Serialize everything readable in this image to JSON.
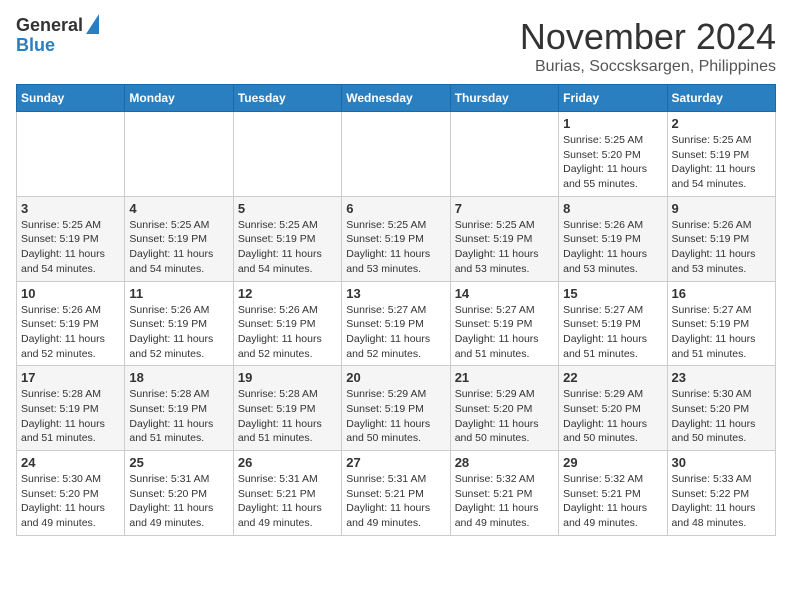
{
  "logo": {
    "line1": "General",
    "line2": "Blue"
  },
  "title": "November 2024",
  "subtitle": "Burias, Soccsksargen, Philippines",
  "weekdays": [
    "Sunday",
    "Monday",
    "Tuesday",
    "Wednesday",
    "Thursday",
    "Friday",
    "Saturday"
  ],
  "weeks": [
    [
      {
        "day": "",
        "info": ""
      },
      {
        "day": "",
        "info": ""
      },
      {
        "day": "",
        "info": ""
      },
      {
        "day": "",
        "info": ""
      },
      {
        "day": "",
        "info": ""
      },
      {
        "day": "1",
        "info": "Sunrise: 5:25 AM\nSunset: 5:20 PM\nDaylight: 11 hours\nand 55 minutes."
      },
      {
        "day": "2",
        "info": "Sunrise: 5:25 AM\nSunset: 5:19 PM\nDaylight: 11 hours\nand 54 minutes."
      }
    ],
    [
      {
        "day": "3",
        "info": "Sunrise: 5:25 AM\nSunset: 5:19 PM\nDaylight: 11 hours\nand 54 minutes."
      },
      {
        "day": "4",
        "info": "Sunrise: 5:25 AM\nSunset: 5:19 PM\nDaylight: 11 hours\nand 54 minutes."
      },
      {
        "day": "5",
        "info": "Sunrise: 5:25 AM\nSunset: 5:19 PM\nDaylight: 11 hours\nand 54 minutes."
      },
      {
        "day": "6",
        "info": "Sunrise: 5:25 AM\nSunset: 5:19 PM\nDaylight: 11 hours\nand 53 minutes."
      },
      {
        "day": "7",
        "info": "Sunrise: 5:25 AM\nSunset: 5:19 PM\nDaylight: 11 hours\nand 53 minutes."
      },
      {
        "day": "8",
        "info": "Sunrise: 5:26 AM\nSunset: 5:19 PM\nDaylight: 11 hours\nand 53 minutes."
      },
      {
        "day": "9",
        "info": "Sunrise: 5:26 AM\nSunset: 5:19 PM\nDaylight: 11 hours\nand 53 minutes."
      }
    ],
    [
      {
        "day": "10",
        "info": "Sunrise: 5:26 AM\nSunset: 5:19 PM\nDaylight: 11 hours\nand 52 minutes."
      },
      {
        "day": "11",
        "info": "Sunrise: 5:26 AM\nSunset: 5:19 PM\nDaylight: 11 hours\nand 52 minutes."
      },
      {
        "day": "12",
        "info": "Sunrise: 5:26 AM\nSunset: 5:19 PM\nDaylight: 11 hours\nand 52 minutes."
      },
      {
        "day": "13",
        "info": "Sunrise: 5:27 AM\nSunset: 5:19 PM\nDaylight: 11 hours\nand 52 minutes."
      },
      {
        "day": "14",
        "info": "Sunrise: 5:27 AM\nSunset: 5:19 PM\nDaylight: 11 hours\nand 51 minutes."
      },
      {
        "day": "15",
        "info": "Sunrise: 5:27 AM\nSunset: 5:19 PM\nDaylight: 11 hours\nand 51 minutes."
      },
      {
        "day": "16",
        "info": "Sunrise: 5:27 AM\nSunset: 5:19 PM\nDaylight: 11 hours\nand 51 minutes."
      }
    ],
    [
      {
        "day": "17",
        "info": "Sunrise: 5:28 AM\nSunset: 5:19 PM\nDaylight: 11 hours\nand 51 minutes."
      },
      {
        "day": "18",
        "info": "Sunrise: 5:28 AM\nSunset: 5:19 PM\nDaylight: 11 hours\nand 51 minutes."
      },
      {
        "day": "19",
        "info": "Sunrise: 5:28 AM\nSunset: 5:19 PM\nDaylight: 11 hours\nand 51 minutes."
      },
      {
        "day": "20",
        "info": "Sunrise: 5:29 AM\nSunset: 5:19 PM\nDaylight: 11 hours\nand 50 minutes."
      },
      {
        "day": "21",
        "info": "Sunrise: 5:29 AM\nSunset: 5:20 PM\nDaylight: 11 hours\nand 50 minutes."
      },
      {
        "day": "22",
        "info": "Sunrise: 5:29 AM\nSunset: 5:20 PM\nDaylight: 11 hours\nand 50 minutes."
      },
      {
        "day": "23",
        "info": "Sunrise: 5:30 AM\nSunset: 5:20 PM\nDaylight: 11 hours\nand 50 minutes."
      }
    ],
    [
      {
        "day": "24",
        "info": "Sunrise: 5:30 AM\nSunset: 5:20 PM\nDaylight: 11 hours\nand 49 minutes."
      },
      {
        "day": "25",
        "info": "Sunrise: 5:31 AM\nSunset: 5:20 PM\nDaylight: 11 hours\nand 49 minutes."
      },
      {
        "day": "26",
        "info": "Sunrise: 5:31 AM\nSunset: 5:21 PM\nDaylight: 11 hours\nand 49 minutes."
      },
      {
        "day": "27",
        "info": "Sunrise: 5:31 AM\nSunset: 5:21 PM\nDaylight: 11 hours\nand 49 minutes."
      },
      {
        "day": "28",
        "info": "Sunrise: 5:32 AM\nSunset: 5:21 PM\nDaylight: 11 hours\nand 49 minutes."
      },
      {
        "day": "29",
        "info": "Sunrise: 5:32 AM\nSunset: 5:21 PM\nDaylight: 11 hours\nand 49 minutes."
      },
      {
        "day": "30",
        "info": "Sunrise: 5:33 AM\nSunset: 5:22 PM\nDaylight: 11 hours\nand 48 minutes."
      }
    ]
  ]
}
